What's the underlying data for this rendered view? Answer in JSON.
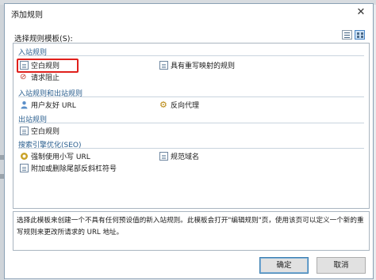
{
  "window": {
    "title": "添加规则",
    "close_glyph": "✕"
  },
  "prompt_label": "选择规则模板(S):",
  "groups": [
    {
      "label": "入站规则",
      "items": [
        {
          "label": "空白规则",
          "icon": "blank-doc-icon",
          "selected": true
        },
        {
          "label": "具有重写映射的规则",
          "icon": "map-doc-icon"
        },
        {
          "label": "请求阻止",
          "icon": "block-icon"
        }
      ]
    },
    {
      "label": "入站规则和出站规则",
      "items": [
        {
          "label": "用户友好 URL",
          "icon": "friendly-url-icon"
        },
        {
          "label": "反向代理",
          "icon": "reverse-proxy-icon"
        }
      ]
    },
    {
      "label": "出站规则",
      "items": [
        {
          "label": "空白规则",
          "icon": "blank-doc-icon"
        }
      ]
    },
    {
      "label": "搜索引擎优化(SEO)",
      "items": [
        {
          "label": "强制使用小写 URL",
          "icon": "lowercase-icon"
        },
        {
          "label": "规范域名",
          "icon": "canonical-domain-icon"
        },
        {
          "label": "附加或删除尾部反斜杠符号",
          "icon": "slash-icon"
        }
      ]
    }
  ],
  "description": "选择此模板来创建一个不具有任何预设值的新入站规则。此模板会打开\"编辑规则\"页，使用该页可以定义一个新的重写规则来更改所请求的 URL 地址。",
  "buttons": {
    "ok": "确定",
    "cancel": "取消"
  },
  "colors": {
    "group_label": "#2b5f8f",
    "selection_outline": "#e0201c"
  }
}
